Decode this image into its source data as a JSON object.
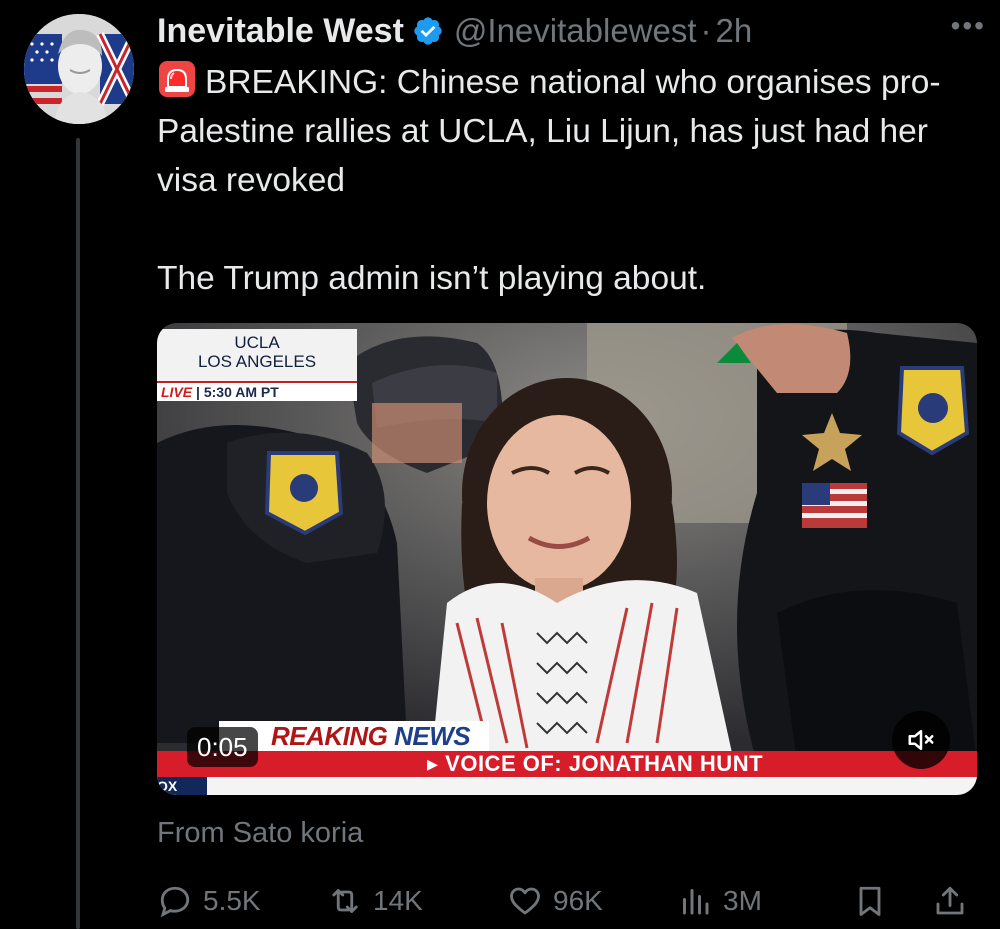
{
  "author": {
    "display_name": "Inevitable West",
    "handle": "@Inevitablewest",
    "separator": "·",
    "time": "2h",
    "verified": true,
    "avatar_icon": "statue-flag-avatar"
  },
  "tweet": {
    "line1": "BREAKING: Chinese national who organises pro-Palestine rallies at UCLA, Liu Lijun, has just had her visa revoked",
    "line2": "The Trump admin isn’t playing about.",
    "emoji_icon": "police-siren-icon"
  },
  "video": {
    "timer": "0:05",
    "overlay": {
      "location_line1": "UCLA",
      "location_line2": "LOS ANGELES",
      "live_label": "LIVE",
      "live_separator": "|",
      "live_time": "5:30 AM PT",
      "breaking_part1": "REAKING",
      "breaking_part2": "NEWS",
      "voice_of": "▸ VOICE OF: JONATHAN HUNT",
      "channel": "OX"
    }
  },
  "source_label": "From Sato koria",
  "metrics": {
    "replies": "5.5K",
    "reposts": "14K",
    "likes": "96K",
    "views": "3M"
  },
  "colors": {
    "background": "#000000",
    "text": "#e7e9ea",
    "secondary": "#71767b",
    "verified": "#1d9bf0"
  }
}
